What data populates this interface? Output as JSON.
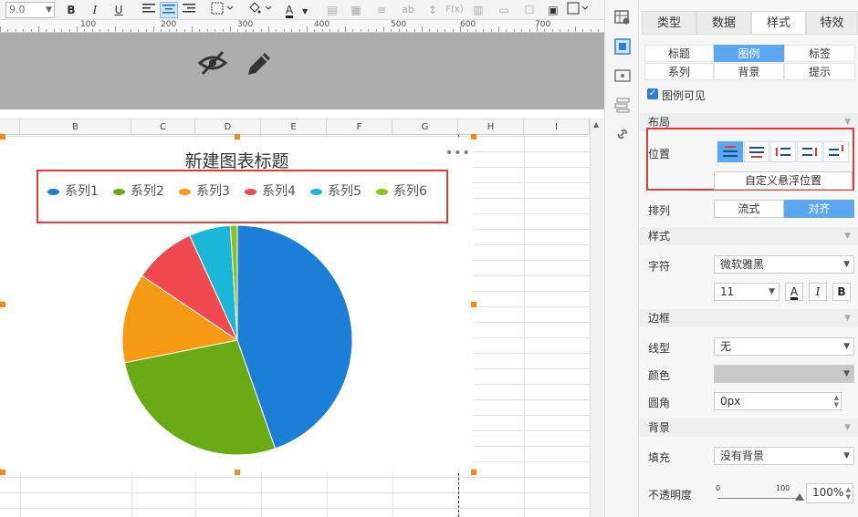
{
  "toolbar": {
    "font_size": "9.0",
    "bold": "B",
    "italic": "I",
    "underline": "U",
    "font_color_letter": "A",
    "grey_ab": "ab",
    "grey_fx": "F(x)"
  },
  "ruler": {
    "labels": [
      "100",
      "200",
      "300",
      "400",
      "500",
      "600",
      "700"
    ]
  },
  "columns": [
    "B",
    "C",
    "D",
    "E",
    "F",
    "G",
    "H",
    "I"
  ],
  "chart": {
    "title": "新建图表标题",
    "more": "•••",
    "colors": [
      "#1b7fd8",
      "#6aaa14",
      "#f59a12",
      "#f0484e",
      "#1bb7d8",
      "#8cc21e"
    ]
  },
  "chart_data": {
    "type": "pie",
    "title": "新建图表标题",
    "legend_position": "top",
    "categories": [
      "系列1",
      "系列2",
      "系列3",
      "系列4",
      "系列5",
      "系列6"
    ],
    "values": [
      46,
      28,
      13,
      9,
      6,
      1
    ]
  },
  "panel": {
    "top_tabs": [
      "类型",
      "数据",
      "样式",
      "特效"
    ],
    "active_top_tab": 2,
    "sub_tabs": [
      "标题",
      "图例",
      "标签",
      "系列",
      "背景",
      "提示"
    ],
    "active_sub_tab": 1,
    "legend_visible_label": "图例可见",
    "layout_label": "布局",
    "position_label": "位置",
    "custom_float_label": "自定义悬浮位置",
    "arrange_label": "排列",
    "arrange_options": [
      "流式",
      "对齐"
    ],
    "active_arrange": 1,
    "style_section": "样式",
    "font_label": "字符",
    "font_value": "微软雅黑",
    "font_size_value": "11",
    "fmt_a": "A",
    "fmt_i": "I",
    "fmt_b": "B",
    "border_section": "边框",
    "line_type_label": "线型",
    "line_type_value": "无",
    "color_label": "颜色",
    "radius_label": "圆角",
    "radius_value": "0px",
    "background_section": "背景",
    "fill_label": "填充",
    "fill_value": "没有背景",
    "opacity_label": "不透明度",
    "opacity_min": "0",
    "opacity_max": "100",
    "opacity_value": "100%"
  }
}
